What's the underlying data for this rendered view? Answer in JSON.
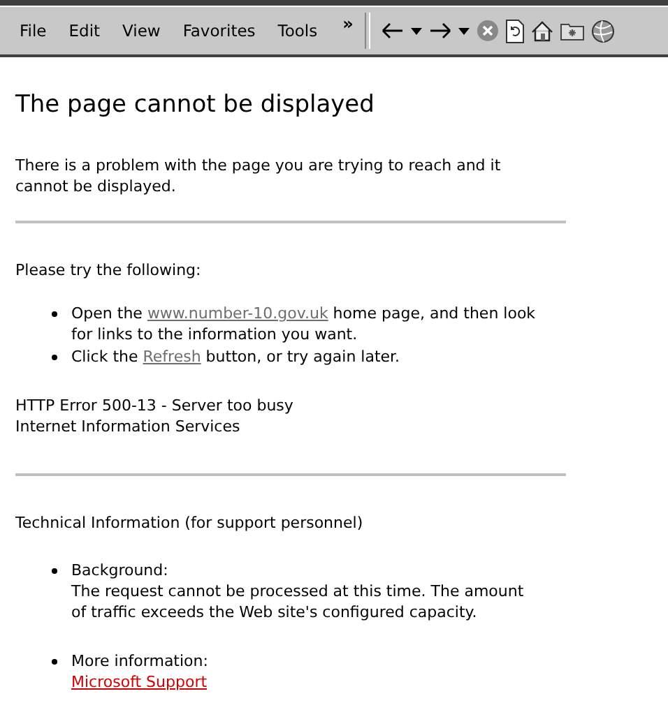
{
  "menu_bar": {
    "items": [
      {
        "label": "File"
      },
      {
        "label": "Edit"
      },
      {
        "label": "View"
      },
      {
        "label": "Favorites"
      },
      {
        "label": "Tools"
      }
    ],
    "overflow": "»"
  },
  "page": {
    "title": "The page cannot be displayed",
    "intro": "There is a problem with the page you are trying to reach and it cannot be displayed.",
    "try_heading": "Please try the following:",
    "suggestions": [
      {
        "before": "Open the ",
        "link": {
          "text": "www.number-10.gov.uk",
          "visited": true
        },
        "after": " home page, and then look for links to the information you want."
      },
      {
        "before": "Click the ",
        "link": {
          "text": "Refresh",
          "visited": true
        },
        "after": " button, or try again later."
      }
    ],
    "error_lines": [
      "HTTP Error 500-13 - Server too busy",
      "Internet Information Services"
    ],
    "tech_heading": "Technical Information (for support personnel)",
    "tech_items": [
      {
        "heading": "Background:",
        "body": "The request cannot be processed at this time. The amount of traffic exceeds the Web site's configured capacity."
      },
      {
        "heading": "More information:",
        "link": {
          "text": "Microsoft Support",
          "visited": false
        }
      }
    ]
  }
}
